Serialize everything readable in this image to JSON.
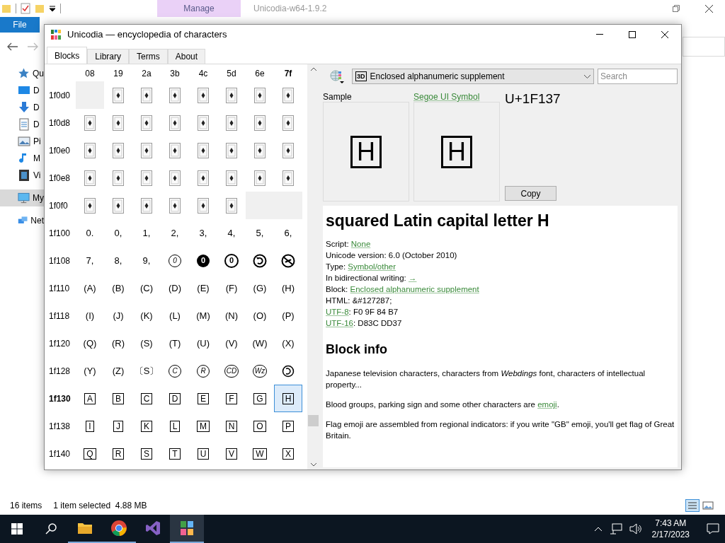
{
  "explorer": {
    "title": "Unicodia-w64-1.9.2",
    "context_tab": "Manage",
    "file_tab": "File",
    "nav_items": [
      {
        "label": "Qu",
        "selected": false
      },
      {
        "label": "D",
        "selected": false
      },
      {
        "label": "D",
        "selected": false
      },
      {
        "label": "D",
        "selected": false
      },
      {
        "label": "Pi",
        "selected": false
      },
      {
        "label": "M",
        "selected": false
      },
      {
        "label": "Vi",
        "selected": false
      },
      {
        "label": "My",
        "selected": true
      },
      {
        "label": "Net",
        "selected": false
      }
    ],
    "status": {
      "count": "16 items",
      "selection": "1 item selected  4.88 MB"
    }
  },
  "window": {
    "title": "Unicodia — encyclopedia of characters",
    "tabs": [
      {
        "label": "Blocks",
        "selected": true
      },
      {
        "label": "Library",
        "selected": false
      },
      {
        "label": "Terms",
        "selected": false
      },
      {
        "label": "About",
        "selected": false
      }
    ],
    "grid": {
      "columns": [
        {
          "label": "08",
          "current": false
        },
        {
          "label": "19",
          "current": false
        },
        {
          "label": "2a",
          "current": false
        },
        {
          "label": "3b",
          "current": false
        },
        {
          "label": "4c",
          "current": false
        },
        {
          "label": "5d",
          "current": false
        },
        {
          "label": "6e",
          "current": false
        },
        {
          "label": "7f",
          "current": true
        }
      ],
      "rows": [
        {
          "label": "1f0d0",
          "current": false,
          "cells": [
            {
              "kind": "empty",
              "selected": false
            },
            {
              "kind": "card",
              "selected": false
            },
            {
              "kind": "card",
              "selected": false
            },
            {
              "kind": "card",
              "selected": false
            },
            {
              "kind": "card",
              "selected": false
            },
            {
              "kind": "card",
              "selected": false
            },
            {
              "kind": "card",
              "selected": false
            },
            {
              "kind": "card",
              "selected": false
            }
          ]
        },
        {
          "label": "1f0d8",
          "current": false,
          "cells": [
            {
              "kind": "card",
              "selected": false
            },
            {
              "kind": "card",
              "selected": false
            },
            {
              "kind": "card",
              "selected": false
            },
            {
              "kind": "card",
              "selected": false
            },
            {
              "kind": "card",
              "selected": false
            },
            {
              "kind": "card",
              "selected": false
            },
            {
              "kind": "card",
              "selected": false
            },
            {
              "kind": "card",
              "selected": false
            }
          ]
        },
        {
          "label": "1f0e0",
          "current": false,
          "cells": [
            {
              "kind": "card",
              "selected": false
            },
            {
              "kind": "card",
              "selected": false
            },
            {
              "kind": "card",
              "selected": false
            },
            {
              "kind": "card",
              "selected": false
            },
            {
              "kind": "card",
              "selected": false
            },
            {
              "kind": "card",
              "selected": false
            },
            {
              "kind": "card",
              "selected": false
            },
            {
              "kind": "card",
              "selected": false
            }
          ]
        },
        {
          "label": "1f0e8",
          "current": false,
          "cells": [
            {
              "kind": "card",
              "selected": false
            },
            {
              "kind": "card",
              "selected": false
            },
            {
              "kind": "card",
              "selected": false
            },
            {
              "kind": "card",
              "selected": false
            },
            {
              "kind": "card",
              "selected": false
            },
            {
              "kind": "card",
              "selected": false
            },
            {
              "kind": "card",
              "selected": false
            },
            {
              "kind": "card",
              "selected": false
            }
          ]
        },
        {
          "label": "1f0f0",
          "current": false,
          "cells": [
            {
              "kind": "card",
              "selected": false
            },
            {
              "kind": "card",
              "selected": false
            },
            {
              "kind": "card",
              "selected": false
            },
            {
              "kind": "card",
              "selected": false
            },
            {
              "kind": "card",
              "selected": false
            },
            {
              "kind": "card",
              "selected": false
            },
            {
              "kind": "empty",
              "selected": false
            },
            {
              "kind": "empty",
              "selected": false
            }
          ]
        },
        {
          "label": "1f100",
          "current": false,
          "cells": [
            {
              "kind": "plain",
              "text": "0.",
              "selected": false
            },
            {
              "kind": "plain",
              "text": "0,",
              "selected": false
            },
            {
              "kind": "plain",
              "text": "1,",
              "selected": false
            },
            {
              "kind": "plain",
              "text": "2,",
              "selected": false
            },
            {
              "kind": "plain",
              "text": "3,",
              "selected": false
            },
            {
              "kind": "plain",
              "text": "4,",
              "selected": false
            },
            {
              "kind": "plain",
              "text": "5,",
              "selected": false
            },
            {
              "kind": "plain",
              "text": "6,",
              "selected": false
            }
          ]
        },
        {
          "label": "1f108",
          "current": false,
          "cells": [
            {
              "kind": "plain",
              "text": "7,",
              "selected": false
            },
            {
              "kind": "plain",
              "text": "8,",
              "selected": false
            },
            {
              "kind": "plain",
              "text": "9,",
              "selected": false
            },
            {
              "kind": "circle",
              "text": "0",
              "selected": false
            },
            {
              "kind": "circle-filled",
              "text": "0",
              "selected": false
            },
            {
              "kind": "circle-bold",
              "text": "0",
              "selected": false
            },
            {
              "kind": "circle-arrow",
              "selected": false
            },
            {
              "kind": "circle-slash",
              "selected": false
            }
          ]
        },
        {
          "label": "1f110",
          "current": false,
          "cells": [
            {
              "kind": "plain",
              "text": "(A)",
              "selected": false
            },
            {
              "kind": "plain",
              "text": "(B)",
              "selected": false
            },
            {
              "kind": "plain",
              "text": "(C)",
              "selected": false
            },
            {
              "kind": "plain",
              "text": "(D)",
              "selected": false
            },
            {
              "kind": "plain",
              "text": "(E)",
              "selected": false
            },
            {
              "kind": "plain",
              "text": "(F)",
              "selected": false
            },
            {
              "kind": "plain",
              "text": "(G)",
              "selected": false
            },
            {
              "kind": "plain",
              "text": "(H)",
              "selected": false
            }
          ]
        },
        {
          "label": "1f118",
          "current": false,
          "cells": [
            {
              "kind": "plain",
              "text": "(I)",
              "selected": false
            },
            {
              "kind": "plain",
              "text": "(J)",
              "selected": false
            },
            {
              "kind": "plain",
              "text": "(K)",
              "selected": false
            },
            {
              "kind": "plain",
              "text": "(L)",
              "selected": false
            },
            {
              "kind": "plain",
              "text": "(M)",
              "selected": false
            },
            {
              "kind": "plain",
              "text": "(N)",
              "selected": false
            },
            {
              "kind": "plain",
              "text": "(O)",
              "selected": false
            },
            {
              "kind": "plain",
              "text": "(P)",
              "selected": false
            }
          ]
        },
        {
          "label": "1f120",
          "current": false,
          "cells": [
            {
              "kind": "plain",
              "text": "(Q)",
              "selected": false
            },
            {
              "kind": "plain",
              "text": "(R)",
              "selected": false
            },
            {
              "kind": "plain",
              "text": "(S)",
              "selected": false
            },
            {
              "kind": "plain",
              "text": "(T)",
              "selected": false
            },
            {
              "kind": "plain",
              "text": "(U)",
              "selected": false
            },
            {
              "kind": "plain",
              "text": "(V)",
              "selected": false
            },
            {
              "kind": "plain",
              "text": "(W)",
              "selected": false
            },
            {
              "kind": "plain",
              "text": "(X)",
              "selected": false
            }
          ]
        },
        {
          "label": "1f128",
          "current": false,
          "cells": [
            {
              "kind": "plain",
              "text": "(Y)",
              "selected": false
            },
            {
              "kind": "plain",
              "text": "(Z)",
              "selected": false
            },
            {
              "kind": "plain",
              "text": "〔S〕",
              "selected": false
            },
            {
              "kind": "circle",
              "text": "C",
              "selected": false
            },
            {
              "kind": "circle",
              "text": "R",
              "selected": false
            },
            {
              "kind": "circle",
              "text": "CD",
              "selected": false
            },
            {
              "kind": "circle",
              "text": "Wz",
              "selected": false
            },
            {
              "kind": "copyleft",
              "selected": false
            }
          ]
        },
        {
          "label": "1f130",
          "current": true,
          "cells": [
            {
              "kind": "square",
              "text": "A",
              "selected": false
            },
            {
              "kind": "square",
              "text": "B",
              "selected": false
            },
            {
              "kind": "square",
              "text": "C",
              "selected": false
            },
            {
              "kind": "square",
              "text": "D",
              "selected": false
            },
            {
              "kind": "square",
              "text": "E",
              "selected": false
            },
            {
              "kind": "square",
              "text": "F",
              "selected": false
            },
            {
              "kind": "square",
              "text": "G",
              "selected": false
            },
            {
              "kind": "square",
              "text": "H",
              "selected": true
            }
          ]
        },
        {
          "label": "1f138",
          "current": false,
          "cells": [
            {
              "kind": "square",
              "text": "I",
              "selected": false
            },
            {
              "kind": "square",
              "text": "J",
              "selected": false
            },
            {
              "kind": "square",
              "text": "K",
              "selected": false
            },
            {
              "kind": "square",
              "text": "L",
              "selected": false
            },
            {
              "kind": "square",
              "text": "M",
              "selected": false
            },
            {
              "kind": "square",
              "text": "N",
              "selected": false
            },
            {
              "kind": "square",
              "text": "O",
              "selected": false
            },
            {
              "kind": "square",
              "text": "P",
              "selected": false
            }
          ]
        },
        {
          "label": "1f140",
          "current": false,
          "cells": [
            {
              "kind": "square",
              "text": "Q",
              "selected": false
            },
            {
              "kind": "square",
              "text": "R",
              "selected": false
            },
            {
              "kind": "square",
              "text": "S",
              "selected": false
            },
            {
              "kind": "square",
              "text": "T",
              "selected": false
            },
            {
              "kind": "square",
              "text": "U",
              "selected": false
            },
            {
              "kind": "square",
              "text": "V",
              "selected": false
            },
            {
              "kind": "square",
              "text": "W",
              "selected": false
            },
            {
              "kind": "square",
              "text": "X",
              "selected": false
            }
          ]
        }
      ]
    },
    "block_select": {
      "icon_text": "3D",
      "value": "Enclosed alphanumeric supplement"
    },
    "search": {
      "placeholder": "Search"
    },
    "samples": [
      {
        "label": "Sample",
        "link": false,
        "kind": "square",
        "text": "H"
      },
      {
        "label": "Segoe UI Symbol",
        "link": true,
        "kind": "square",
        "text": "H"
      }
    ],
    "codepoint": "U+1F137",
    "copy_button": "Copy",
    "char_title": "squared Latin capital letter H",
    "properties": [
      [
        {
          "text": "Script: ",
          "link": false
        },
        {
          "text": "None",
          "link": true
        }
      ],
      [
        {
          "text": "Unicode version: 6.0 (October 2010)",
          "link": false
        }
      ],
      [
        {
          "text": "Type: ",
          "link": false
        },
        {
          "text": "Symbol/other",
          "link": true
        }
      ],
      [
        {
          "text": "In bidirectional writing: ",
          "link": false
        },
        {
          "text": "→",
          "link": true
        }
      ],
      [
        {
          "text": "Block: ",
          "link": false
        },
        {
          "text": "Enclosed alphanumeric supplement",
          "link": true
        }
      ],
      [
        {
          "text": "HTML: &#127287;",
          "link": false
        }
      ],
      [
        {
          "text": "UTF-8",
          "link": true
        },
        {
          "text": ": F0 9F 84 B7",
          "link": false
        }
      ],
      [
        {
          "text": "UTF-16",
          "link": true
        },
        {
          "text": ": D83C DD37",
          "link": false
        }
      ]
    ],
    "block_heading": "Block info",
    "paragraphs": [
      [
        {
          "text": "Japanese television characters, characters from *Webdings* font, characters of intellectual property...",
          "link": false
        }
      ],
      [
        {
          "text": "Blood groups, parking sign and some other characters are ",
          "link": false
        },
        {
          "text": "emoji",
          "link": true
        },
        {
          "text": ".",
          "link": false
        }
      ],
      [
        {
          "text": "Flag emoji are assembled from regional indicators: if you write \"GB\" emoji, you'll get flag of Great Britain.",
          "link": false
        }
      ]
    ]
  },
  "taskbar": {
    "apps": [
      {
        "active": false,
        "open": true
      },
      {
        "active": false,
        "open": true
      },
      {
        "active": false,
        "open": false
      },
      {
        "active": true,
        "open": true
      }
    ],
    "time": "7:43 AM",
    "date": "2/17/2023"
  }
}
